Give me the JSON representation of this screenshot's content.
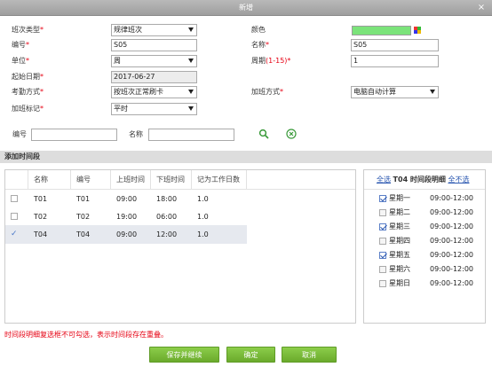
{
  "window": {
    "title": "新增",
    "close_glyph": "×"
  },
  "form": {
    "shift_type_label": "班次类型",
    "shift_type_value": "规律班次",
    "color_label": "颜色",
    "color_value": "#7be37a",
    "number_label": "编号",
    "number_value": "S05",
    "name_label": "名称",
    "name_value": "S05",
    "unit_label": "单位",
    "unit_value": "周",
    "cycle_label": "周期",
    "cycle_range": "(1-15)",
    "cycle_value": "1",
    "start_date_label": "起始日期",
    "start_date_value": "2017-06-27",
    "attendance_method_label": "考勤方式",
    "attendance_method_value": "按班次正常刷卡",
    "overtime_method_label": "加班方式",
    "overtime_method_value": "电脑自动计算",
    "overtime_flag_label": "加班标记",
    "overtime_flag_value": "平时"
  },
  "search": {
    "number_label": "编号",
    "number_value": "",
    "name_label": "名称",
    "name_value": "",
    "search_icon": "search-icon",
    "clear_icon": "clear-icon"
  },
  "section": {
    "title": "添加时间段"
  },
  "table": {
    "headers": [
      "名称",
      "编号",
      "上班时间",
      "下班时间",
      "记为工作日数"
    ],
    "rows": [
      {
        "checked": false,
        "name": "T01",
        "code": "T01",
        "on": "09:00",
        "off": "18:00",
        "days": "1.0"
      },
      {
        "checked": false,
        "name": "T02",
        "code": "T02",
        "on": "19:00",
        "off": "06:00",
        "days": "1.0"
      },
      {
        "checked": true,
        "name": "T04",
        "code": "T04",
        "on": "09:00",
        "off": "12:00",
        "days": "1.0"
      }
    ]
  },
  "detail": {
    "select_all": "全选",
    "title": "T04 时间段明细",
    "select_none": "全不选",
    "days": [
      {
        "label": "星期一",
        "time": "09:00-12:00",
        "checked": true
      },
      {
        "label": "星期二",
        "time": "09:00-12:00",
        "checked": false
      },
      {
        "label": "星期三",
        "time": "09:00-12:00",
        "checked": true
      },
      {
        "label": "星期四",
        "time": "09:00-12:00",
        "checked": false
      },
      {
        "label": "星期五",
        "time": "09:00-12:00",
        "checked": true
      },
      {
        "label": "星期六",
        "time": "09:00-12:00",
        "checked": false
      },
      {
        "label": "星期日",
        "time": "09:00-12:00",
        "checked": false
      }
    ]
  },
  "note": "时间段明细复选框不可勾选，表示时间段存在重叠。",
  "buttons": {
    "save_continue": "保存并继续",
    "ok": "确定",
    "cancel": "取消"
  },
  "colors": {
    "accent_green": "#7cbe3e",
    "required_red": "#e60012",
    "link_blue": "#2a57b0"
  }
}
